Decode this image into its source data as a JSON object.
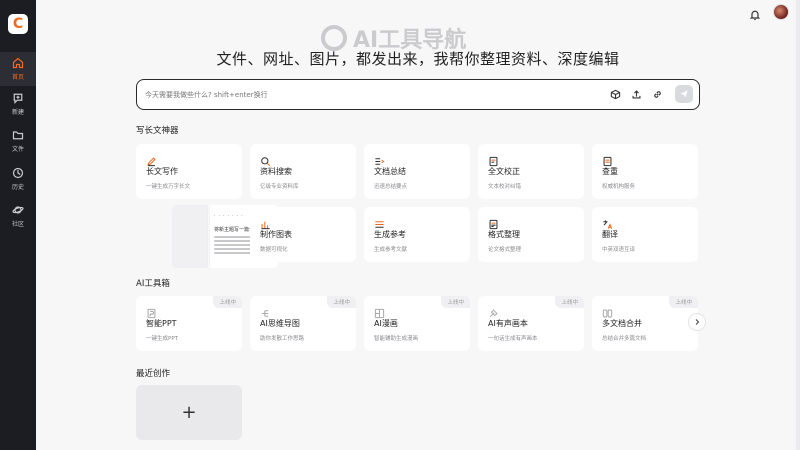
{
  "brand": {
    "logo_letter": "C",
    "accent": "#f26b1d"
  },
  "sidebar": {
    "items": [
      {
        "label": "首页",
        "icon": "home-icon",
        "active": true
      },
      {
        "label": "新建",
        "icon": "new-chat-icon",
        "active": false
      },
      {
        "label": "文件",
        "icon": "folder-icon",
        "active": false
      },
      {
        "label": "历史",
        "icon": "clock-icon",
        "active": false
      },
      {
        "label": "社区",
        "icon": "planet-icon",
        "active": false
      }
    ]
  },
  "topbar": {
    "bell": "bell-icon",
    "avatar": "user-avatar"
  },
  "watermark": {
    "text": "AI工具导航"
  },
  "headline": "文件、网址、图片，都发出来，我帮你整理资料、深度编辑",
  "search": {
    "placeholder": "今天需要我做些什么? shift+enter换行",
    "icons": [
      "cube-icon",
      "upload-icon",
      "link-icon"
    ],
    "send_icon": "send-icon"
  },
  "sections": {
    "writing": {
      "title": "写长文神器",
      "cards": [
        {
          "title": "长文写作",
          "desc": "一键生成万字长文",
          "icon": "pen-icon"
        },
        {
          "title": "资料搜索",
          "desc": "亿级专业资料库",
          "icon": "search-icon"
        },
        {
          "title": "文档总结",
          "desc": "迅速总结要点",
          "icon": "list-icon"
        },
        {
          "title": "全文校正",
          "desc": "文本校对纠错",
          "icon": "proofread-icon"
        },
        {
          "title": "查重",
          "desc": "权威机构服务",
          "icon": "check-doc-icon"
        },
        {
          "title": "制作图表",
          "desc": "数据可视化",
          "icon": "chart-icon"
        },
        {
          "title": "生成参考",
          "desc": "生成参考文献",
          "icon": "reference-icon"
        },
        {
          "title": "格式整理",
          "desc": "论文格式整理",
          "icon": "format-icon"
        },
        {
          "title": "翻译",
          "desc": "中英双语互译",
          "icon": "translate-icon"
        }
      ],
      "preview": {
        "header": "· · · · · · ·",
        "title": "将新主题写一篇长文..."
      }
    },
    "ai_tools": {
      "title": "AI工具箱",
      "cards": [
        {
          "title": "智能PPT",
          "desc": "一键生成PPT",
          "badge": "上线中",
          "icon": "ppt-icon"
        },
        {
          "title": "AI思维导图",
          "desc": "助你发散工作思路",
          "badge": "上线中",
          "icon": "mindmap-icon"
        },
        {
          "title": "AI漫画",
          "desc": "智能辅助生成漫画",
          "badge": "上线中",
          "icon": "comic-icon"
        },
        {
          "title": "AI有声画本",
          "desc": "一句话生成有声画本",
          "badge": "上线中",
          "icon": "audio-book-icon"
        },
        {
          "title": "多文档合并",
          "desc": "总结合并多篇文档",
          "badge": "上线中",
          "icon": "merge-icon"
        }
      ],
      "next_icon": "chevron-right-icon"
    },
    "recent": {
      "title": "最近创作",
      "new_symbol": "+"
    }
  }
}
